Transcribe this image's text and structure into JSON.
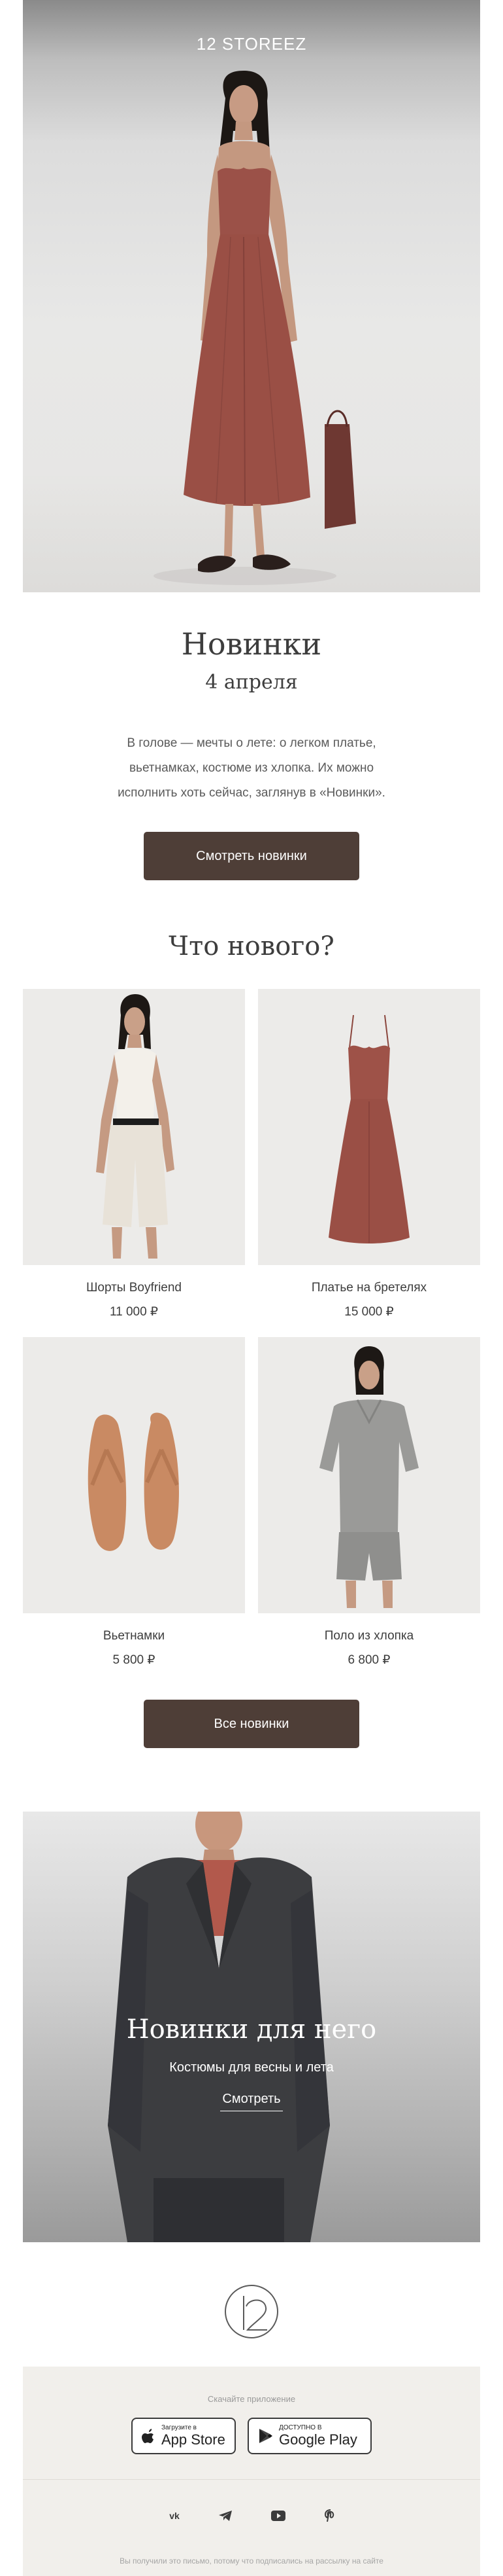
{
  "hero": {
    "logo": "12 STOREEZ"
  },
  "intro": {
    "title": "Новинки",
    "date": "4 апреля",
    "text_line1": "В голове — мечты о лете: о легком платье,",
    "text_line2": "вьетнамках, костюме из хлопка. Их можно",
    "text_line3": "исполнить хоть сейчас, заглянув в «Новинки».",
    "button": "Смотреть новинки"
  },
  "whats_new": {
    "title": "Что нового?",
    "products": [
      {
        "name": "Шорты Boyfriend",
        "price": "11 000 ₽"
      },
      {
        "name": "Платье на бретелях",
        "price": "15 000 ₽"
      },
      {
        "name": "Вьетнамки",
        "price": "5 800 ₽"
      },
      {
        "name": "Поло из хлопка",
        "price": "6 800 ₽"
      }
    ],
    "button": "Все новинки"
  },
  "for_him": {
    "title": "Новинки для него",
    "subtitle": "Костюмы для весны и лета",
    "link": "Смотреть"
  },
  "footer": {
    "apps_label": "Скачайте приложение",
    "appstore_small": "Загрузите в",
    "appstore_big": "App Store",
    "googleplay_small": "ДОСТУПНО В",
    "googleplay_big": "Google Play",
    "social": [
      "vk-icon",
      "telegram-icon",
      "youtube-icon",
      "pinterest-icon"
    ],
    "legal": "Вы получили это письмо, потому что подписались на рассылку на сайте"
  },
  "colors": {
    "button": "#4e3e37",
    "dress": "#9b5148",
    "footer_bg": "#f1efeb"
  }
}
